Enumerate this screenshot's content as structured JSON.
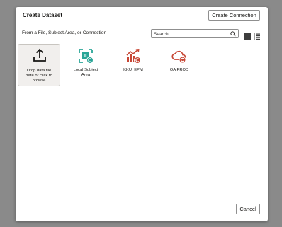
{
  "dialog": {
    "title": "Create Dataset",
    "create_connection_label": "Create Connection",
    "source_label": "From a File, Subject Area, or Connection",
    "search": {
      "placeholder": "Search"
    },
    "cancel_label": "Cancel"
  },
  "tiles": [
    {
      "label": "Drop data file here or click to browse",
      "icon": "upload-icon"
    },
    {
      "label": "Local Subject Area",
      "icon": "subject-area-icon"
    },
    {
      "label": "KKU_EPM",
      "icon": "chart-connection-icon"
    },
    {
      "label": "OA PROD",
      "icon": "cloud-connection-icon"
    }
  ],
  "colors": {
    "teal": "#2aa597",
    "red": "#c74634",
    "overlay": "#8a8a8a"
  }
}
